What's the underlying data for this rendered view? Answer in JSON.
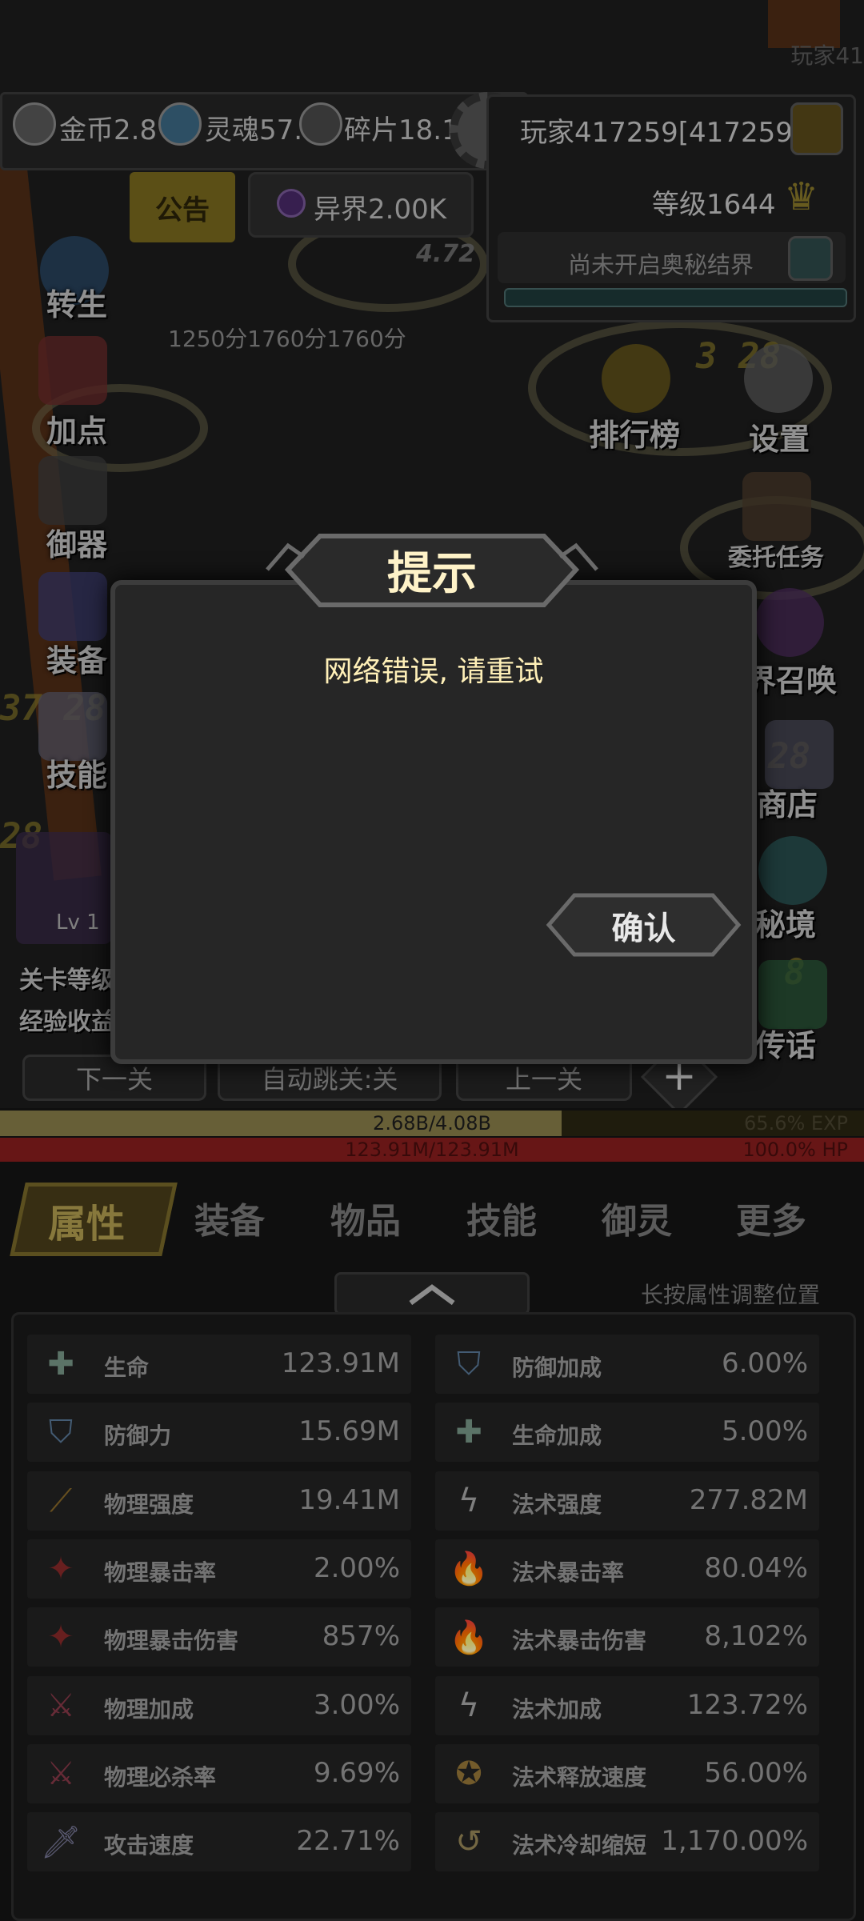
{
  "hud": {
    "corner_player": "玩家41",
    "resources": [
      {
        "icon": "gold-coin-icon",
        "text": "金币2.8"
      },
      {
        "icon": "soul-icon",
        "text": "灵魂57."
      },
      {
        "icon": "fragment-icon",
        "text": "碎片18.1"
      }
    ],
    "notice_label": "公告",
    "otherworld": {
      "icon": "otherworld-icon",
      "text": "异界2.00K"
    },
    "player_name": "玩家417259[417259]",
    "level": "等级1644",
    "realm_status": "尚未开启奥秘结界",
    "bg_value": "4.72",
    "scores": "1250分1760分1760分"
  },
  "left_menu": [
    {
      "name": "rebirth",
      "label": "转生",
      "icon": "rebirth-icon"
    },
    {
      "name": "add-points",
      "label": "加点",
      "icon": "meat-icon"
    },
    {
      "name": "spirit-control",
      "label": "御器",
      "icon": "sword-icon"
    },
    {
      "name": "equipment",
      "label": "装备",
      "icon": "shield-icon"
    },
    {
      "name": "skills",
      "label": "技能",
      "icon": "scroll-icon"
    }
  ],
  "pet": {
    "level": "Lv 1"
  },
  "stage_info": {
    "line1": "关卡等级",
    "line2": "经验收益"
  },
  "right_menu": [
    {
      "name": "ranking",
      "label": "排行榜",
      "icon": "trophy-icon"
    },
    {
      "name": "settings",
      "label": "设置",
      "icon": "gear-icon"
    },
    {
      "name": "commission",
      "label": "委托任务",
      "icon": "book-icon"
    },
    {
      "name": "summon",
      "label": "界召唤",
      "icon": "vortex-icon"
    },
    {
      "name": "shop",
      "label": "商店",
      "icon": "diamond-icon"
    },
    {
      "name": "secret-realm",
      "label": "秘境",
      "icon": "portal-icon"
    },
    {
      "name": "legend",
      "label": "传话",
      "icon": "horn-icon"
    }
  ],
  "nav_buttons": {
    "prev": "下一关",
    "auto": "自动跳关:关",
    "next": "上一关"
  },
  "exp": {
    "text": "2.68B/4.08B",
    "percent": "65.6%",
    "unit": "EXP",
    "fraction": 0.656
  },
  "hp": {
    "text": "123.91M/123.91M",
    "percent": "100.0%",
    "unit": "HP",
    "fraction": 1.0
  },
  "tabs": [
    "属性",
    "装备",
    "物品",
    "技能",
    "御灵",
    "更多"
  ],
  "hint": "长按属性调整位置",
  "stats_left": [
    {
      "icon": "cross-icon",
      "name": "生命",
      "value": "123.91M"
    },
    {
      "icon": "shield-icon",
      "name": "防御力",
      "value": "15.69M"
    },
    {
      "icon": "claw-icon",
      "name": "物理强度",
      "value": "19.41M"
    },
    {
      "icon": "crit-icon",
      "name": "物理暴击率",
      "value": "2.00%"
    },
    {
      "icon": "crit-icon",
      "name": "物理暴击伤害",
      "value": "857%"
    },
    {
      "icon": "slash-icon",
      "name": "物理加成",
      "value": "3.00%"
    },
    {
      "icon": "slash-icon",
      "name": "物理必杀率",
      "value": "9.69%"
    },
    {
      "icon": "sword-icon",
      "name": "攻击速度",
      "value": "22.71%"
    }
  ],
  "stats_right": [
    {
      "icon": "shield-icon",
      "name": "防御加成",
      "value": "6.00%"
    },
    {
      "icon": "cross-icon",
      "name": "生命加成",
      "value": "5.00%"
    },
    {
      "icon": "lightning-icon",
      "name": "法术强度",
      "value": "277.82M"
    },
    {
      "icon": "flame-icon",
      "name": "法术暴击率",
      "value": "80.04%"
    },
    {
      "icon": "flame-icon",
      "name": "法术暴击伤害",
      "value": "8,102%"
    },
    {
      "icon": "lightning-icon",
      "name": "法术加成",
      "value": "123.72%"
    },
    {
      "icon": "badge-icon",
      "name": "法术释放速度",
      "value": "56.00%"
    },
    {
      "icon": "cooldown-icon",
      "name": "法术冷却缩短",
      "value": "1,170.00%"
    }
  ],
  "dialog": {
    "title": "提示",
    "message": "网络错误, 请重试",
    "confirm": "确认"
  },
  "colors": {
    "accent_gold": "#b4a050",
    "hp_red": "#8a1e1e",
    "exp_gold": "#8a7f4a",
    "dialog_text": "#fff0b8"
  }
}
